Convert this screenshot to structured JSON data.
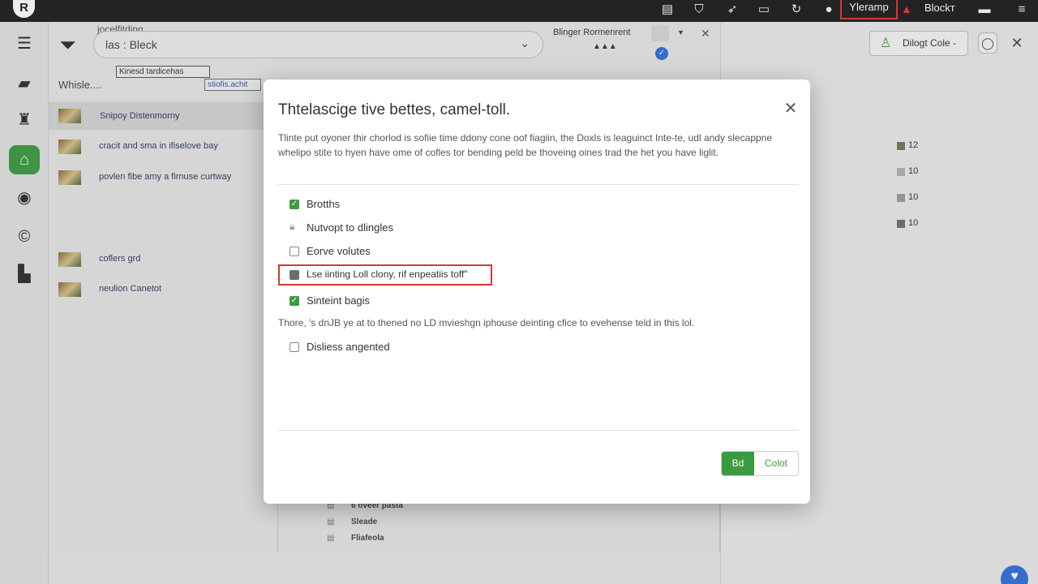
{
  "topbar": {
    "logo": "R",
    "highlighted_item": "Yleramp",
    "user_label": "Blockт"
  },
  "search": {
    "label": "jocelfitding",
    "value": "las : Bleck"
  },
  "chips": {
    "chip_a": "Kinesd tardicehas",
    "chip_b": "stiofis.achit"
  },
  "list": {
    "heading": "Whisle....",
    "items": [
      {
        "label": "Snipoy Distenmorny"
      },
      {
        "label": "cracit and sma in ifiselove bay"
      },
      {
        "label": "povlen fibe amy a firnuse curtway"
      },
      {
        "label": "coflers grd"
      },
      {
        "label": "neulion Canetot"
      }
    ]
  },
  "doc_rows": [
    "6 oveer pasta",
    "Sleade",
    "Fliafeola"
  ],
  "middle": {
    "header": "Blinger Rormenrent",
    "stars": "▲▲▲"
  },
  "right_panel": {
    "button_label": "Dilogt Cole -",
    "legend": [
      {
        "value": "12",
        "color": "#6a7a5a"
      },
      {
        "value": "10",
        "color": "#b3b3b3"
      },
      {
        "value": "10",
        "color": "#9e9e9e"
      },
      {
        "value": "10",
        "color": "#6f6f6f"
      }
    ]
  },
  "modal": {
    "title": "Thtelascige tive bettes, camel-toll.",
    "description": "Tlinte put oyoner thir chorlod is sofiie time ddony cone oof fiagiin, the Doxls is leaguinct Inte-te, udl andy slecappne whelipo stite to hyen have ome of cofles tor bending peld be thoveing oines trad the het you have liglit.",
    "options": [
      {
        "label": "Brotths",
        "state": "checked"
      },
      {
        "label": "Nutvopt to dlingles",
        "state": "locked"
      },
      {
        "label": "Eorve volutes",
        "state": "unchecked"
      },
      {
        "label": "Lse iinting Loll clony, rif enpeatiis toff\"",
        "state": "partial"
      },
      {
        "label": "Sinteint bagis",
        "state": "checked"
      }
    ],
    "note": "Thore, 's dnJB ye at to thened no LD mvieshgn iphouse deinting cfice to evehense teld in this lol.",
    "extra_option": {
      "label": "Disliess angented",
      "state": "unchecked"
    },
    "primary_button": "Bd",
    "secondary_button": "Colot"
  }
}
